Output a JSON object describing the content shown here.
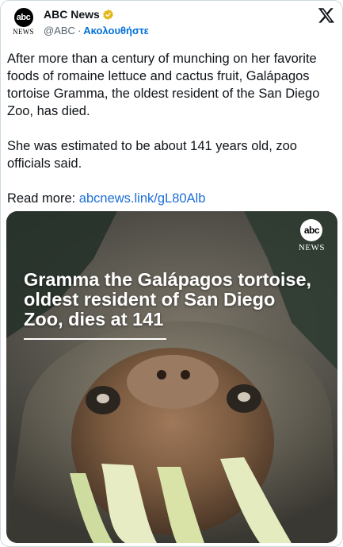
{
  "account": {
    "name": "ABC News",
    "handle": "@ABC",
    "separator": "·",
    "follow_label": "Ακολουθήστε",
    "avatar": {
      "logo_text": "abc",
      "logo_word": "NEWS"
    }
  },
  "icons": {
    "verified": "verified-badge-icon",
    "brand": "x-logo-icon"
  },
  "colors": {
    "verified_gold": "#e2b719",
    "link_blue": "#1d6fd6",
    "text": "#0f1419",
    "muted": "#536471"
  },
  "tweet": {
    "paragraph1": "After more than a century of munching on her favorite foods of romaine lettuce and cactus fruit, Galápagos tortoise Gramma, the oldest resident of the San Diego Zoo, has died.",
    "paragraph2": "She was estimated to be about 141 years old, zoo officials said.",
    "read_more_label": "Read more: ",
    "link_text": "abcnews.link/gL80Alb"
  },
  "media": {
    "headline": "Gramma the Galápagos tortoise, oldest resident of San Diego Zoo, dies at 141",
    "logo_text": "abc",
    "logo_word": "NEWS"
  }
}
